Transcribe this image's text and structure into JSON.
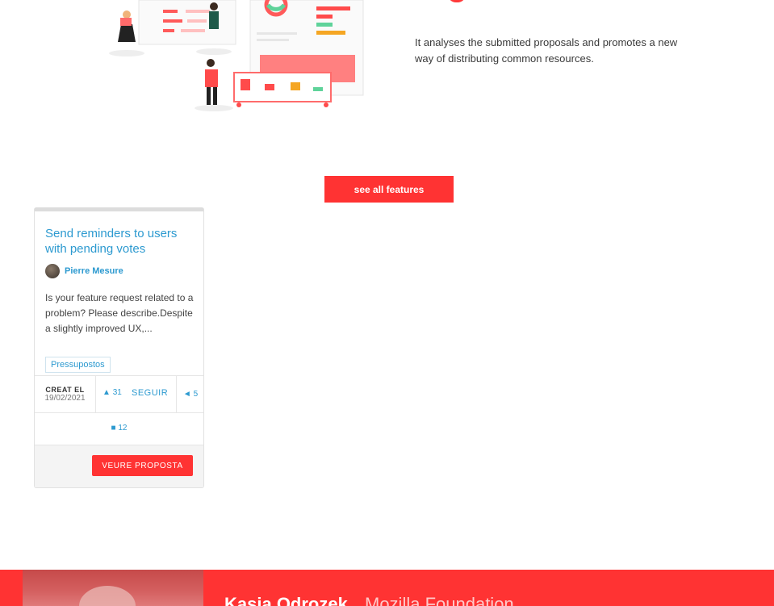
{
  "feature": {
    "description": "It analyses the submitted proposals and promotes a new way of distributing common resources."
  },
  "see_all_button": "see all features",
  "proposal_card": {
    "title": "Send reminders to users with pending votes",
    "author": "Pierre Mesure",
    "excerpt": "Is your feature request related to a problem? Please describe.Despite a slightly improved UX,...",
    "tag": "Pressupostos",
    "created_label": "CREAT EL",
    "created_date": "19/02/2021",
    "supports_count": "31",
    "follow_label": "SEGUIR",
    "shares_count": "5",
    "comments_count": "12",
    "view_button": "VEURE PROPOSTA",
    "icons": {
      "supports": "bell-icon",
      "shares": "megaphone-icon",
      "comments": "comment-icon"
    }
  },
  "testimonial": {
    "name": "Kasia Odrozek",
    "organization": "Mozilla Foundation"
  },
  "colors": {
    "accent": "#ff3333",
    "link": "#2d9ad0"
  }
}
